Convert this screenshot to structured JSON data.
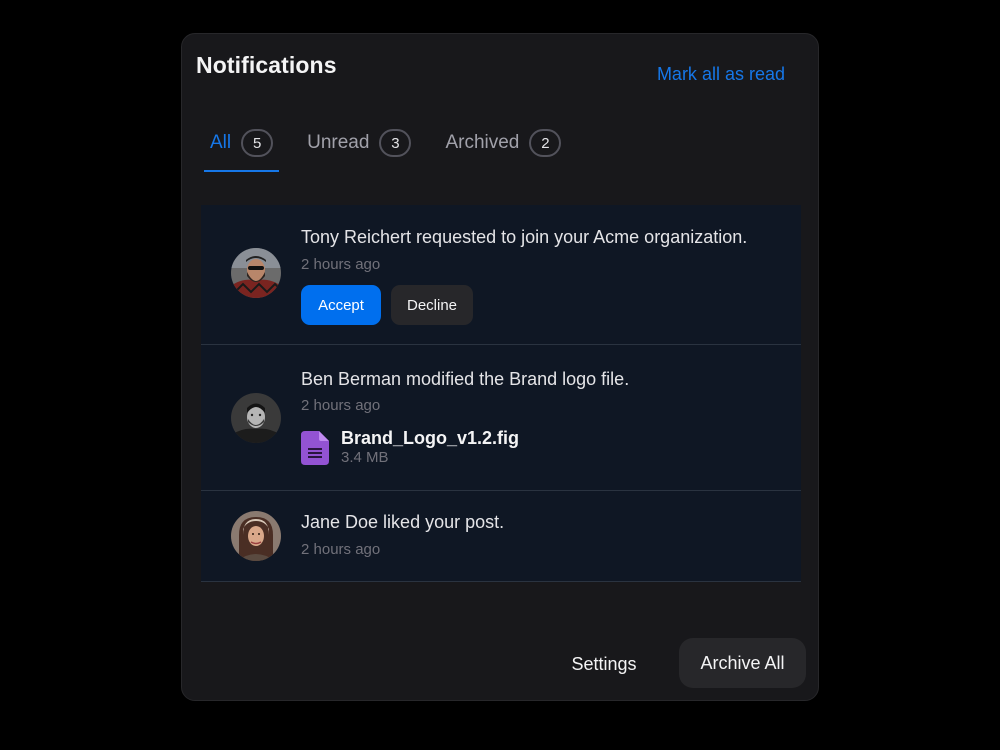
{
  "header": {
    "title": "Notifications",
    "mark_all_label": "Mark all as read"
  },
  "tabs": [
    {
      "label": "All",
      "count": "5",
      "active": true
    },
    {
      "label": "Unread",
      "count": "3",
      "active": false
    },
    {
      "label": "Archived",
      "count": "2",
      "active": false
    }
  ],
  "notifications": [
    {
      "text": "Tony Reichert requested to join your Acme organization.",
      "time": "2 hours ago",
      "avatar": "avatar-tony-reichert",
      "actions": {
        "accept_label": "Accept",
        "decline_label": "Decline"
      }
    },
    {
      "text": "Ben Berman modified the Brand logo file.",
      "time": "2 hours ago",
      "avatar": "avatar-ben-berman",
      "file": {
        "name": "Brand_Logo_v1.2.fig",
        "size": "3.4 MB",
        "icon": "document-icon"
      }
    },
    {
      "text": "Jane Doe liked your post.",
      "time": "2 hours ago",
      "avatar": "avatar-jane-doe"
    }
  ],
  "footer": {
    "settings_label": "Settings",
    "archive_all_label": "Archive All"
  },
  "colors": {
    "accent": "#1677E8",
    "primary_button": "#006FEE",
    "file_icon": "#9353D3",
    "panel_bg": "#18181B",
    "list_bg": "#0F1724"
  }
}
